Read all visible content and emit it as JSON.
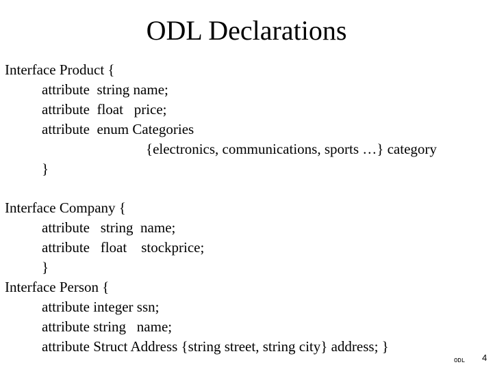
{
  "slide": {
    "title": "ODL Declarations",
    "lines": [
      {
        "indent": 0,
        "text": "Interface Product {"
      },
      {
        "indent": 1,
        "text": "attribute  string name;"
      },
      {
        "indent": 1,
        "text": "attribute  float   price;"
      },
      {
        "indent": 1,
        "text": "attribute  enum Categories"
      },
      {
        "indent": 2,
        "text": "{electronics, communications, sports …} category"
      },
      {
        "indent": 1,
        "text": "}"
      },
      {
        "indent": 0,
        "text": ""
      },
      {
        "indent": 0,
        "text": "Interface Company {"
      },
      {
        "indent": 1,
        "text": "attribute   string  name;"
      },
      {
        "indent": 1,
        "text": "attribute   float    stockprice;"
      },
      {
        "indent": 1,
        "text": "}"
      },
      {
        "indent": 0,
        "text": "Interface Person {"
      },
      {
        "indent": 1,
        "text": "attribute integer ssn;"
      },
      {
        "indent": 1,
        "text": "attribute string   name;"
      },
      {
        "indent": 1,
        "text": "attribute Struct Address {string street, string city} address; }"
      }
    ],
    "footer": "ODL",
    "page_number": "4"
  }
}
